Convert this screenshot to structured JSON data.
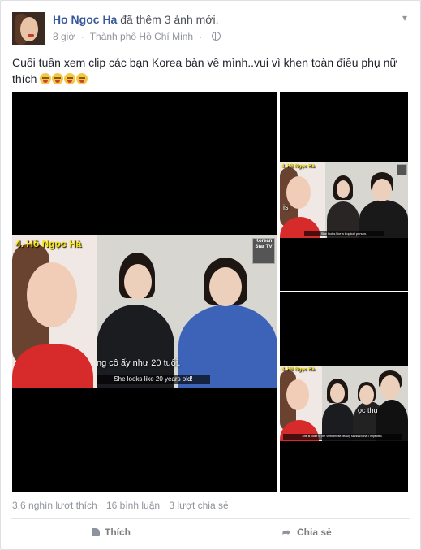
{
  "post": {
    "author": "Ho Ngoc Ha",
    "action": "đã thêm 3 ảnh mới.",
    "time": "8 giờ",
    "location": "Thành phố Hồ Chí Minh",
    "separator": "·",
    "chevron": "▾",
    "text": "Cuối tuần xem clip các bạn Korea bàn về mình..vui vì khen toàn điều phụ nữ thích",
    "emoji_count": 4
  },
  "photos": {
    "main": {
      "tag": "4. Hồ Ngọc Hà",
      "logo": "Korean Star TV",
      "viet_sub": "ng cô ấy như 20 tuổi.",
      "sub": "She looks like 20 years old!"
    },
    "top_right": {
      "tag": "4. Hồ Ngọc Hà",
      "viet_sub": "is",
      "sub": "She looks like a tropical person."
    },
    "bottom_right": {
      "tag": "4. Hồ Ngọc Hà",
      "viet_sub": "ọc thụ",
      "sub": "She is close to the Vietnamese beauty standard that I expected."
    }
  },
  "stats": {
    "likes": "3,6 nghìn lượt thích",
    "comments": "16 bình luận",
    "shares": "3 lượt chia sẻ"
  },
  "actions": {
    "like": "Thích",
    "share": "Chia sẻ"
  },
  "icons": {
    "like": "thumbs-up-icon",
    "share": "share-arrow-icon",
    "privacy": "globe-icon",
    "menu": "chevron-down-icon"
  }
}
